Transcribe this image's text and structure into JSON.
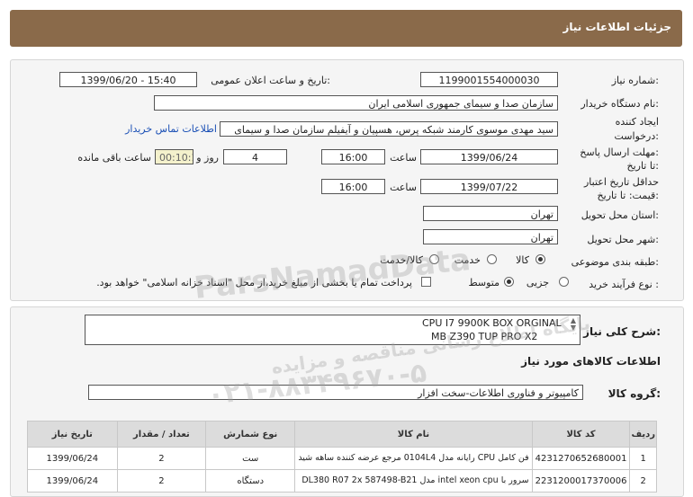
{
  "header": {
    "title": "جزئیات اطلاعات نیاز"
  },
  "form": {
    "need_number_label": "شماره نیاز:",
    "need_number": "1199001554000030",
    "announce_label": "تاریخ و ساعت اعلان عمومی:",
    "announce_value": "1399/06/20 - 15:40",
    "buyer_label": "نام دستگاه خریدار:",
    "buyer_value": "سازمان صدا و سیمای جمهوری اسلامی ایران",
    "creator_label_1": "ایجاد کننده",
    "creator_label_2": "درخواست:",
    "creator_value": "سید مهدی موسوی کارمند شبکه پرس، هسپیان و آیفیلم سازمان صدا و سیمای",
    "contact_link": "اطلاعات تماس خریدار",
    "deadline_label_1": "مهلت ارسال پاسخ:",
    "deadline_label_2": "تا تاریخ:",
    "deadline_date": "1399/06/24",
    "time_label": "ساعت",
    "deadline_time": "16:00",
    "days_value": "4",
    "days_label": "روز و",
    "timer_value": "00:10:15",
    "remaining_label": "ساعت باقی مانده",
    "validity_label_1": "حداقل تاریخ اعتبار",
    "validity_label_2": "قیمت: تا تاریخ:",
    "validity_date": "1399/07/22",
    "validity_time": "16:00",
    "province_label": "استان محل تحویل:",
    "province_value": "تهران",
    "city_label": "شهر محل تحویل:",
    "city_value": "تهران",
    "category_label": "طبقه بندی موضوعی:",
    "category_options": [
      "کالا",
      "خدمت",
      "کالا/خدمت"
    ],
    "category_selected": "کالا",
    "process_label": "نوع فرآیند خرید :",
    "process_options": [
      "جزیی",
      "متوسط"
    ],
    "process_selected": "متوسط",
    "payment_note": "پرداخت تمام یا بخشی از مبلغ خرید،از محل \"اسناد خزانه اسلامی\" خواهد بود."
  },
  "summary": {
    "label": "شرح کلی نیاز:",
    "line1": "CPU I7 9900K BOX ORGINAL",
    "line2": "MB Z390 TUP PRO X2"
  },
  "goods": {
    "section_title": "اطلاعات کالاهای مورد نیاز",
    "group_label": "گروه کالا:",
    "group_value": "کامپیوتر و فناوری اطلاعات-سخت افزار",
    "columns": [
      "ردیف",
      "کد کالا",
      "نام کالا",
      "نوع شمارش",
      "تعداد / مقدار",
      "تاریخ نیاز"
    ],
    "rows": [
      {
        "idx": "1",
        "code": "4231270652680001",
        "name": "فن کامل CPU رایانه مدل 0104L4 مرجع عرضه کننده ساهه شید",
        "unit": "ست",
        "qty": "2",
        "date": "1399/06/24"
      },
      {
        "idx": "2",
        "code": "2231200017370006",
        "name": "سرور با intel xeon cpu مدل DL380 R07 2x 587498-B21",
        "unit": "دستگاه",
        "qty": "2",
        "date": "1399/06/24"
      }
    ]
  },
  "watermark": {
    "brand": "ParsNamadData",
    "line2": "پایگاه اطلاع رسانی مناقصه و مزایده",
    "phone": "۰۲۱-۸۸۳۴۹۶۷۰-۵"
  }
}
